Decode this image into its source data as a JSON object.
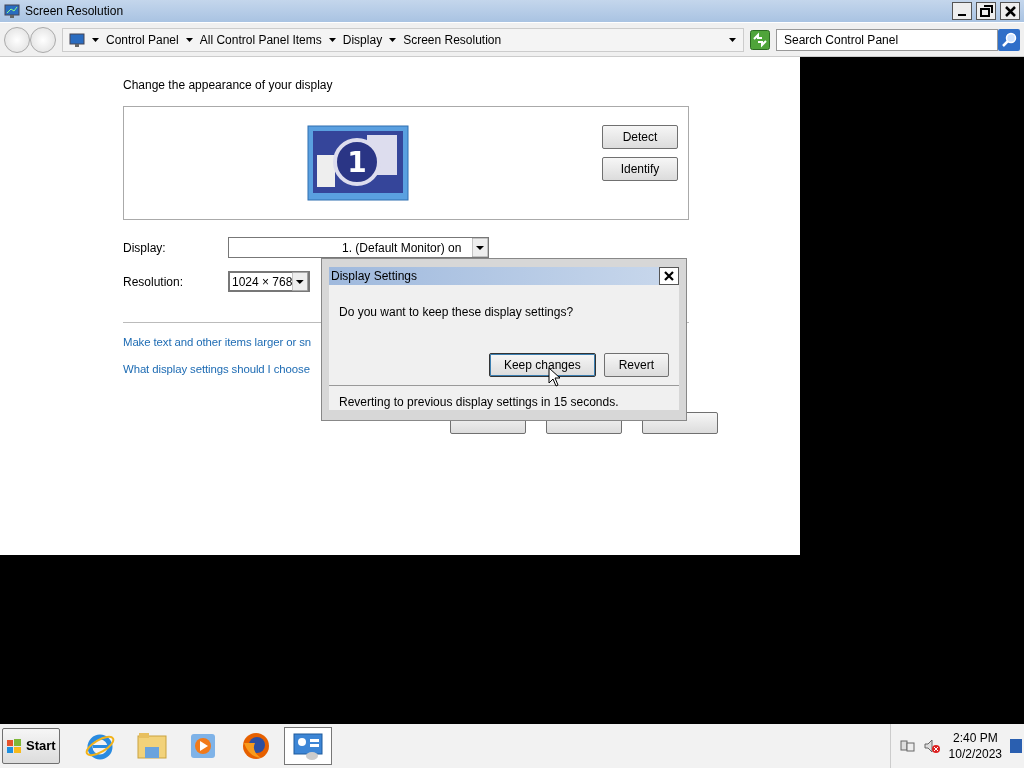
{
  "window": {
    "title": "Screen Resolution"
  },
  "address_bar": {
    "breadcrumbs": [
      "Control Panel",
      "All Control Panel Items",
      "Display",
      "Screen Resolution"
    ]
  },
  "search": {
    "placeholder": "Search Control Panel"
  },
  "content": {
    "heading": "Change the appearance of your display",
    "monitor_label": "1",
    "buttons": [
      "Detect",
      "Identify"
    ],
    "fields": [
      {
        "label": "Display:",
        "value": "1. (Default Monitor) on",
        "kind": "wide"
      },
      {
        "label": "Resolution:",
        "value": "1024 × 768",
        "kind": "narrow"
      }
    ],
    "links": [
      "Make text and other items larger or sn",
      "What display settings should I choose"
    ]
  },
  "dialog": {
    "title": "Display Settings",
    "message": "Do you want to keep these display settings?",
    "buttons": [
      {
        "label": "Keep changes",
        "selected": true
      },
      {
        "label": "Revert",
        "selected": false
      }
    ],
    "footer": "Reverting to previous display settings in 15 seconds."
  },
  "taskbar": {
    "start": "Start",
    "apps": [
      {
        "kind": "browser",
        "selected": false
      },
      {
        "kind": "folder",
        "selected": false
      },
      {
        "kind": "media",
        "selected": false
      },
      {
        "kind": "firefox",
        "selected": false
      },
      {
        "kind": "display",
        "selected": true
      }
    ],
    "time": "2:40 PM",
    "date": "10/2/2023"
  }
}
